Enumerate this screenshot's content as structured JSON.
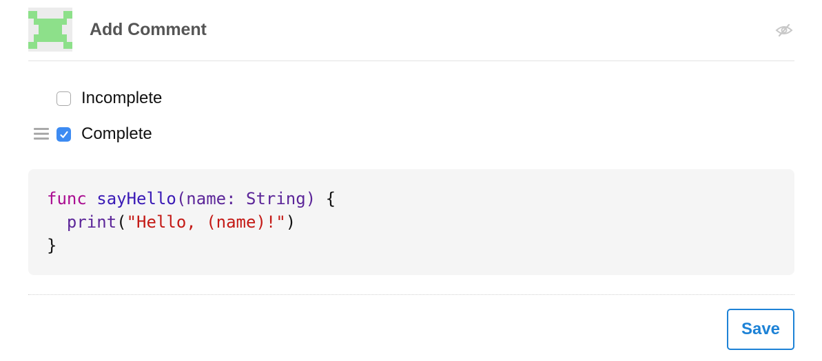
{
  "header": {
    "title": "Add Comment",
    "avatar_icon": "identicon-avatar",
    "avatar_color": "#8de08a",
    "visibility_icon": "eye-slash-icon"
  },
  "tasks": [
    {
      "label": "Incomplete",
      "checked": false
    },
    {
      "label": "Complete",
      "checked": true
    }
  ],
  "code": {
    "language": "swift",
    "line1": {
      "keyword": "func",
      "name": "sayHello",
      "open": "(",
      "param": "name",
      "colon": ":",
      "type": "String",
      "close": ")",
      "brace": "{"
    },
    "line2": {
      "call": "print",
      "open": "(",
      "string": "\"Hello, (name)!\"",
      "close": ")"
    },
    "line3": {
      "brace": "}"
    }
  },
  "actions": {
    "save_label": "Save"
  },
  "colors": {
    "accent": "#1d82d6",
    "checkbox_checked": "#3d8bf2",
    "code_bg": "#f5f5f5"
  }
}
